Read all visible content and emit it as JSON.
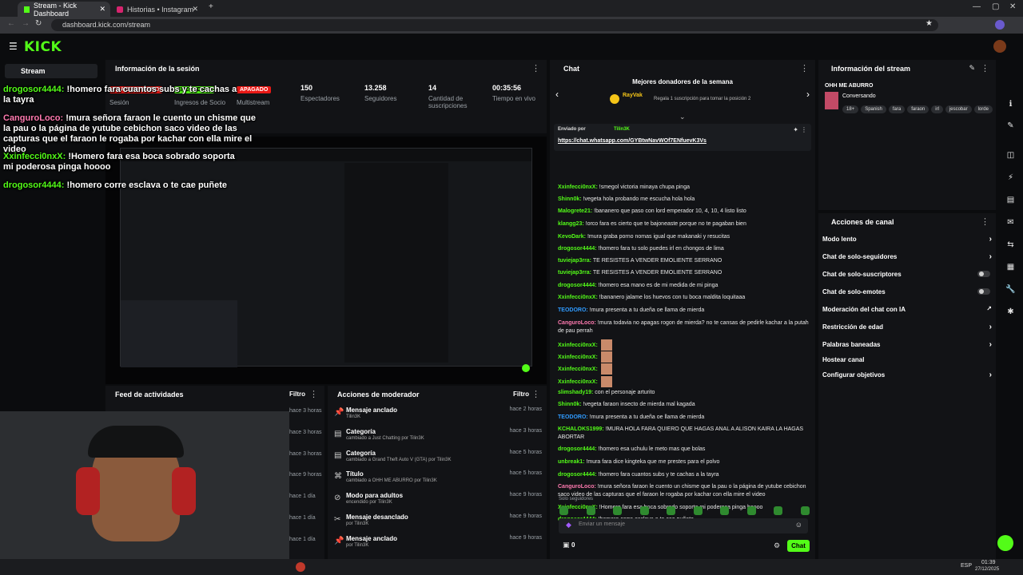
{
  "browser": {
    "tabs": [
      {
        "label": "Stream - Kick Dashboard",
        "active": true
      },
      {
        "label": "Historias • Instagram",
        "active": false
      }
    ],
    "url": "dashboard.kick.com/stream"
  },
  "app": {
    "logo": "KICK",
    "sidebar": {
      "stream_label": "Stream"
    }
  },
  "session": {
    "title": "Información de la sesión",
    "badges": [
      "TRANSMITIENDO",
      "ENCENDIDO",
      "APAGADO"
    ],
    "badge_labels": [
      "Sesión",
      "Ingresos de Socio",
      "Multistream"
    ],
    "stats": [
      {
        "value": "150",
        "label": "Espectadores"
      },
      {
        "value": "13.258",
        "label": "Seguidores"
      },
      {
        "value": "14",
        "label": "Cantidad de suscripciones"
      },
      {
        "value": "00:35:56",
        "label": "Tiempo en vivo"
      }
    ]
  },
  "overlay": [
    {
      "user": "drogosor4444:",
      "text": " !homero fara cuantos subs y te cachas a la tayra"
    },
    {
      "user": "CanguroLoco:",
      "text": " !mura señora faraon le cuento un chisme que la pau o la página de yutube cebichon saco video de las capturas que el faraon le rogaba por kachar con ella mire el video"
    },
    {
      "user": "Xxinfecci0nxX:",
      "text": " !Homero fara esa boca sobrado soporta mi poderosa pinga hoooo"
    },
    {
      "user": "drogosor4444:",
      "text": " !homero corre esclava o te cae puñete"
    }
  ],
  "feed": {
    "title": "Feed de actividades",
    "filter": "Filtro",
    "times": [
      "hace 3 horas",
      "hace 3 horas",
      "hace 3 horas",
      "hace 9 horas",
      "hace 1 día",
      "hace 1 día",
      "hace 1 día"
    ]
  },
  "mod": {
    "title": "Acciones de moderador",
    "filter": "Filtro",
    "rows": [
      {
        "icon": "pin-icon",
        "title": "Mensaje anclado",
        "sub": "Tilin3K",
        "time": "hace 2 horas"
      },
      {
        "icon": "category-icon",
        "title": "Categoría",
        "sub": "cambiado a Just Chatting por Tilin3K",
        "time": "hace 3 horas"
      },
      {
        "icon": "category-icon",
        "title": "Categoría",
        "sub": "cambiado a Grand Theft Auto V (GTA) por Tilin3K",
        "time": "hace 5 horas"
      },
      {
        "icon": "title-icon",
        "title": "Título",
        "sub": "cambiado a OHH ME ABURRO por Tilin3K",
        "time": "hace 5 horas"
      },
      {
        "icon": "adult-icon",
        "title": "Modo para adultos",
        "sub": "encendido por Tilin3K",
        "time": "hace 9 horas"
      },
      {
        "icon": "unpin-icon",
        "title": "Mensaje desanclado",
        "sub": "por Tilin3K",
        "time": "hace 9 horas"
      },
      {
        "icon": "pin-icon",
        "title": "Mensaje anclado",
        "sub": "por Tilin3K",
        "time": "hace 9 horas"
      }
    ]
  },
  "chat": {
    "title": "Chat",
    "donors_title": "Mejores donadores de la semana",
    "donor_name": "RayVak",
    "donor_hint": "Regala 1 suscripción para tomar la posición 2",
    "pinned_by": "Enviado por",
    "pinned_user": "Tilin3K",
    "pinned_link": "https://chat.whatsapp.com/GYBtwNavWOf7ENfuevK3Vs",
    "messages": [
      {
        "user": "Xxinfecci0nxX:",
        "color": "#53fc18",
        "text": " !smegol victoria minaya chupa pinga"
      },
      {
        "user": "Shinn0k:",
        "color": "#53fc18",
        "text": " !vegeta hola probando me escucha hola hola"
      },
      {
        "user": "Malogrete21:",
        "color": "#53fc18",
        "text": " !bananero que paso con lord emperador 10, 4, 10, 4 listo listo"
      },
      {
        "user": "klangg23:",
        "color": "#53fc18",
        "text": " !orco fara es cierto que te bajoneaste porque no te pagaban bien"
      },
      {
        "user": "KevoDark:",
        "color": "#53fc18",
        "text": " !mura graba porno nomas igual que makanaki y resucitas"
      },
      {
        "user": "drogosor4444:",
        "color": "#53fc18",
        "text": " !homero fara tu solo puedes irl en chongos de lima"
      },
      {
        "user": "tuviejap3rra:",
        "color": "#53fc18",
        "text": " TE RESISTES A VENDER EMOLIENTE SERRANO"
      },
      {
        "user": "tuviejap3rra:",
        "color": "#53fc18",
        "text": " TE RESISTES A VENDER EMOLIENTE SERRANO"
      },
      {
        "user": "drogosor4444:",
        "color": "#53fc18",
        "text": " !homero esa mano es de mi medida de mi pinga"
      },
      {
        "user": "Xxinfecci0nxX:",
        "color": "#53fc18",
        "text": " !bananero jalame los huevos con tu boca maldita loquitaaa"
      },
      {
        "user": "TEODORO:",
        "color": "#2f9bff",
        "text": " !mura presenta a tu dueña oe llama de mierda"
      },
      {
        "user": "CanguroLoco:",
        "color": "#ff7ab0",
        "text": " !mura todavia no apagas rogon de mierda? no te cansas de pedirle kachar a la putah de pau perrah"
      },
      {
        "user": "Xxinfecci0nxX:",
        "color": "#53fc18",
        "text": ""
      },
      {
        "user": "Xxinfecci0nxX:",
        "color": "#53fc18",
        "text": ""
      },
      {
        "user": "Xxinfecci0nxX:",
        "color": "#53fc18",
        "text": ""
      },
      {
        "user": "Xxinfecci0nxX:",
        "color": "#53fc18",
        "text": ""
      },
      {
        "user": "slimshady19:",
        "color": "#53fc18",
        "text": " con el personaje arturito"
      },
      {
        "user": "Shinn0k:",
        "color": "#53fc18",
        "text": " !vegeta faraon insecto de mierda mal kagada"
      },
      {
        "user": "TEODORO:",
        "color": "#2f9bff",
        "text": " !mura presenta a tu dueña oe llama de mierda"
      },
      {
        "user": "KCHALOKS1999:",
        "color": "#53fc18",
        "text": " !MURA HOLA FARA QUIERO QUE HAGAS ANAL A ALISON KAIRA LA HAGAS ABORTAR"
      },
      {
        "user": "drogosor4444:",
        "color": "#53fc18",
        "text": " !homero esa uchulu le meto mas que bolas"
      },
      {
        "user": "unbreak1:",
        "color": "#53fc18",
        "text": " !mura fara dice kingteka que me prestes para el polvo"
      },
      {
        "user": "drogosor4444:",
        "color": "#53fc18",
        "text": " !homero fara cuantos subs y te cachas a la tayra"
      },
      {
        "user": "CanguroLoco:",
        "color": "#ff7ab0",
        "text": " !mura señora faraon le cuento un chisme que la pau o la página de yutube cebichon saco video de las capturas que el faraon le rogaba por kachar con ella mire el video"
      },
      {
        "user": "Xxinfecci0nxX:",
        "color": "#53fc18",
        "text": " !Homero fara esa boca sobrado soporta mi poderosa pinga hoooo"
      },
      {
        "user": "drogosor4444:",
        "color": "#53fc18",
        "text": " !homero corre esclava o te cae puñete"
      }
    ],
    "followers_only": "Solo seguidores",
    "input_placeholder": "Enviar un mensaje",
    "points": "0",
    "send_label": "Chat"
  },
  "stream_info": {
    "title": "Información del stream",
    "stream_title": "OHH ME ABURRO",
    "category": "Conversando",
    "tags": [
      "18+",
      "Spanish",
      "fara",
      "faraon",
      "irl",
      "jescobar",
      "lorde"
    ]
  },
  "channel_actions": {
    "title": "Acciones de canal",
    "items": [
      {
        "label": "Modo lento",
        "kind": "arrow"
      },
      {
        "label": "Chat de solo-seguidores",
        "kind": "arrow"
      },
      {
        "label": "Chat de solo-suscriptores",
        "kind": "toggle"
      },
      {
        "label": "Chat de solo-emotes",
        "kind": "toggle"
      },
      {
        "label": "Moderación del chat con IA",
        "kind": "external"
      },
      {
        "label": "Restricción de edad",
        "kind": "arrow"
      },
      {
        "label": "Palabras baneadas",
        "kind": "arrow"
      },
      {
        "label": "Hostear canal",
        "kind": "none"
      },
      {
        "label": "Configurar objetivos",
        "kind": "arrow"
      }
    ]
  },
  "taskbar": {
    "time": "01:39",
    "date": "27/12/2025",
    "lang": "ESP"
  },
  "colors": {
    "accent": "#53fc18",
    "live": "#e91916",
    "panel": "#121316"
  }
}
